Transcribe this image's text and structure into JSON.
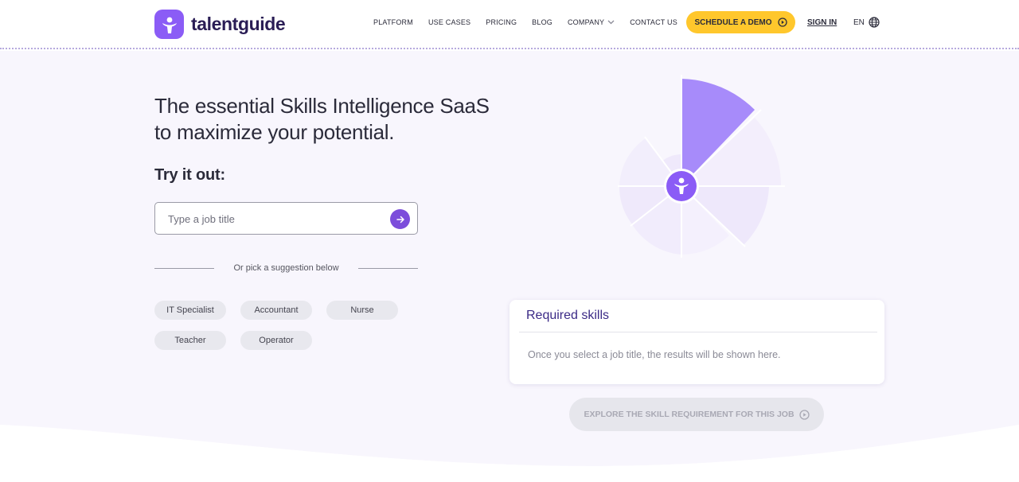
{
  "brand": {
    "name": "talentguide",
    "accent": "#8b5cf6",
    "cta": "#ffc72c"
  },
  "nav": {
    "items": [
      "PLATFORM",
      "USE CASES",
      "PRICING",
      "BLOG",
      "COMPANY",
      "CONTACT US"
    ],
    "company_icon": "chevron-down-icon"
  },
  "header": {
    "demo_label": "SCHEDULE A DEMO",
    "signin_label": "SIGN IN",
    "lang_label": "EN"
  },
  "hero": {
    "headline": "The essential Skills Intelligence SaaS to maximize your potential.",
    "tryit": "Try it out:",
    "search": {
      "placeholder": "Type a job title",
      "value": ""
    },
    "divider_text": "Or pick a suggestion below",
    "suggestions": [
      "IT Specialist",
      "Accountant",
      "Nurse",
      "Teacher",
      "Operator"
    ]
  },
  "skills": {
    "title": "Required skills",
    "empty": "Once you select a job title, the results will be shown here.",
    "explore_label": "EXPLORE THE SKILL REQUIREMENT FOR THIS JOB"
  }
}
